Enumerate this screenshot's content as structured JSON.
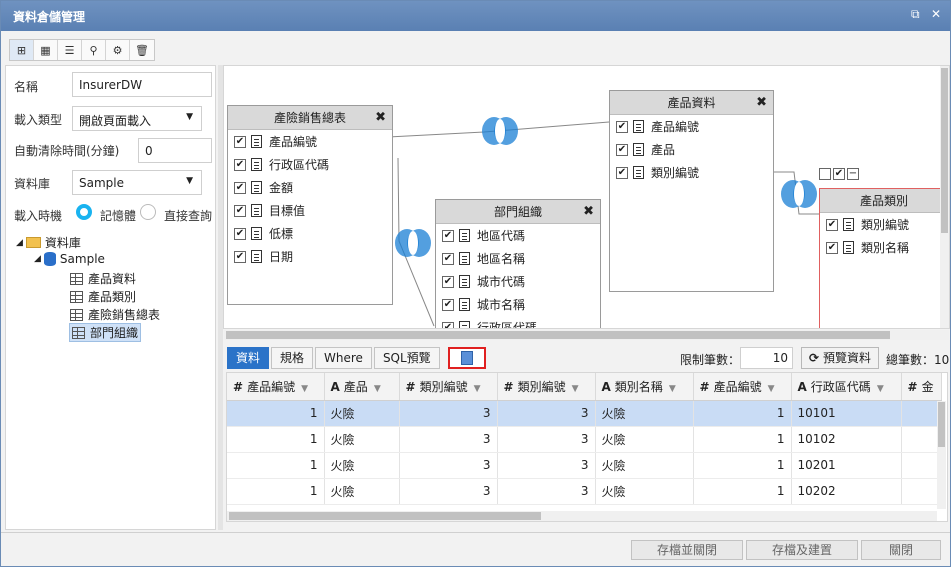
{
  "window": {
    "title": "資料倉儲管理",
    "restore_icon": "restore-icon",
    "close_icon": "close-icon"
  },
  "toolbar": {
    "icons": [
      "relation-diagram-icon",
      "table-grid-icon",
      "tree-list-icon",
      "hierarchy-icon",
      "gear-icon",
      "trash-icon"
    ]
  },
  "form": {
    "name_label": "名稱",
    "name_value": "InsurerDW",
    "load_type_label": "載入類型",
    "load_type_value": "開啟頁面載入",
    "cache_label": "自動清除時間(分鐘)",
    "cache_value": "0",
    "database_label": "資料庫",
    "database_value": "Sample",
    "load_timing_label": "載入時機",
    "option_memory": "記憶體",
    "option_direct": "直接查詢"
  },
  "tree": {
    "root": "資料庫",
    "db": "Sample",
    "tables": [
      "產品資料",
      "產品類別",
      "產險銷售總表",
      "部門組織"
    ],
    "selected_table": "部門組織"
  },
  "entities": {
    "sales": {
      "title": "產險銷售總表",
      "fields": [
        "產品編號",
        "行政區代碼",
        "金額",
        "目標值",
        "低標",
        "日期"
      ]
    },
    "product": {
      "title": "產品資料",
      "fields": [
        "產品編號",
        "產品",
        "類別編號"
      ]
    },
    "dept": {
      "title": "部門組織",
      "fields": [
        "地區代碼",
        "地區名稱",
        "城市代碼",
        "城市名稱",
        "行政區代碼"
      ]
    },
    "category": {
      "title": "產品類別",
      "fields": [
        "類別編號",
        "類別名稱"
      ]
    }
  },
  "tabs": {
    "data": "資料",
    "spec": "規格",
    "where": "Where",
    "sql": "SQL預覽"
  },
  "preview": {
    "limit_label": "限制筆數：",
    "limit_value": "10",
    "preview_button": "預覽資料",
    "total_label": "總筆數：10"
  },
  "grid": {
    "columns": [
      {
        "type": "#",
        "label": "產品編號"
      },
      {
        "type": "A",
        "label": "產品"
      },
      {
        "type": "#",
        "label": "類別編號"
      },
      {
        "type": "#",
        "label": "類別編號"
      },
      {
        "type": "A",
        "label": "類別名稱"
      },
      {
        "type": "#",
        "label": "產品編號"
      },
      {
        "type": "A",
        "label": "行政區代碼"
      },
      {
        "type": "#",
        "label": "金"
      }
    ],
    "rows": [
      [
        "1",
        "火險",
        "3",
        "3",
        "火險",
        "1",
        "10101"
      ],
      [
        "1",
        "火險",
        "3",
        "3",
        "火險",
        "1",
        "10102"
      ],
      [
        "1",
        "火險",
        "3",
        "3",
        "火險",
        "1",
        "10201"
      ],
      [
        "1",
        "火險",
        "3",
        "3",
        "火險",
        "1",
        "10202"
      ]
    ]
  },
  "footer": {
    "save_close": "存檔並關閉",
    "save_build": "存檔及建置",
    "close": "關閉"
  }
}
